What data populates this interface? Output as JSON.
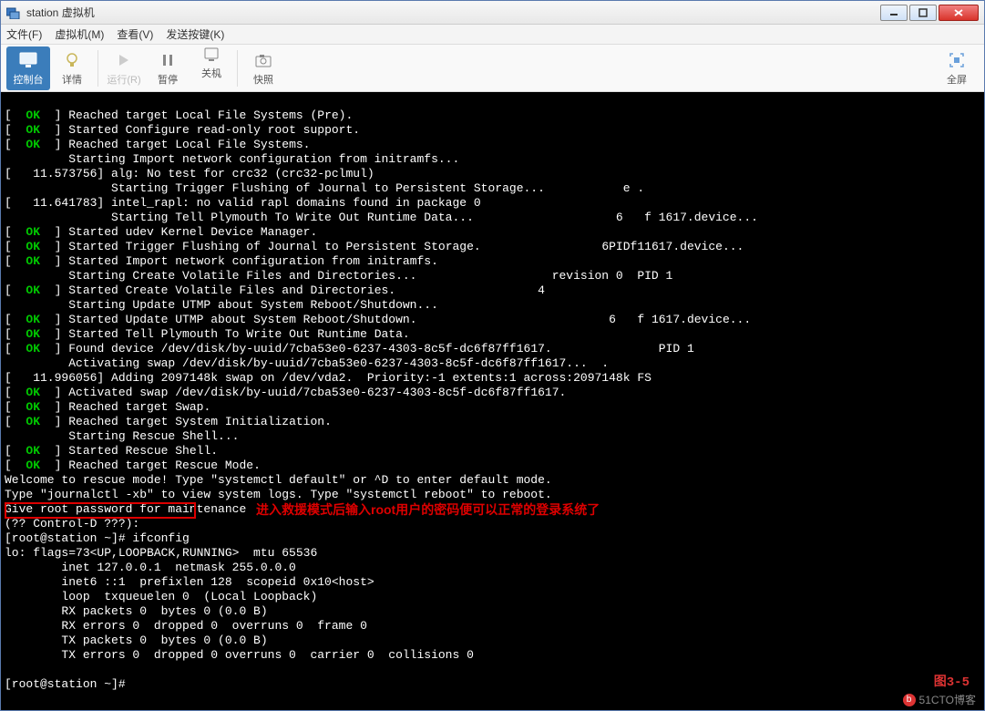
{
  "window": {
    "title": "station 虚拟机"
  },
  "menu": {
    "file": "文件(F)",
    "vm": "虚拟机(M)",
    "view": "查看(V)",
    "send": "发送按键(K)"
  },
  "toolbar": {
    "console": "控制台",
    "details": "详情",
    "run": "运行(R)",
    "pause": "暂停",
    "shutdown": "关机",
    "snapshot": "快照",
    "fullscreen": "全屏"
  },
  "term": {
    "l1": "[   11.573756] alg: No test for crc32 (crc32-pclmul)",
    "l2": "               Starting Trigger Flushing of Journal to Persistent Storage...           e .",
    "l3": "[   11.641783] intel_rapl: no valid rapl domains found in package 0",
    "l4": "               Starting Tell Plymouth To Write Out Runtime Data...                    6   f 1617.device...",
    "ok1": "Reached target Local File Systems (Pre).",
    "ok2": "Started Configure read-only root support.",
    "ok3": "Reached target Local File Systems.",
    "starting_import": "         Starting Import network configuration from initramfs...",
    "ok4": "Started udev Kernel Device Manager.",
    "ok5": "Started Trigger Flushing of Journal to Persistent Storage.                 6PIDf11617.device...",
    "ok6": "Started Import network configuration from initramfs.",
    "starting_volatile": "         Starting Create Volatile Files and Directories...                   revision 0  PID 1",
    "ok7": "Started Create Volatile Files and Directories.                    4",
    "starting_utmp": "         Starting Update UTMP about System Reboot/Shutdown...",
    "ok8": "Started Update UTMP about System Reboot/Shutdown.                           6   f 1617.device...",
    "ok9": "Started Tell Plymouth To Write Out Runtime Data.",
    "ok10": "Found device /dev/disk/by-uuid/7cba53e0-6237-4303-8c5f-dc6f87ff1617.               PID 1",
    "activating": "         Activating swap /dev/disk/by-uuid/7cba53e0-6237-4303-8c5f-dc6f87ff1617...  .",
    "l5": "[   11.996056] Adding 2097148k swap on /dev/vda2.  Priority:-1 extents:1 across:2097148k FS",
    "ok11": "Activated swap /dev/disk/by-uuid/7cba53e0-6237-4303-8c5f-dc6f87ff1617.",
    "ok12": "Reached target Swap.",
    "ok13": "Reached target System Initialization.",
    "starting_rescue": "         Starting Rescue Shell...",
    "ok14": "Started Rescue Shell.",
    "ok15": "Reached target Rescue Mode.",
    "welcome": "Welcome to rescue mode! Type \"systemctl default\" or ^D to enter default mode.",
    "journal": "Type \"journalctl -xb\" to view system logs. Type \"systemctl reboot\" to reboot.",
    "giveroot": "Give root password for maintenance",
    "ctrl_d": "(?? Control-D ???):",
    "prompt1": "[root@station ~]# ifconfig",
    "lo": "lo: flags=73<UP,LOOPBACK,RUNNING>  mtu 65536",
    "inet": "        inet 127.0.0.1  netmask 255.0.0.0",
    "inet6": "        inet6 ::1  prefixlen 128  scopeid 0x10<host>",
    "loop": "        loop  txqueuelen 0  (Local Loopback)",
    "rxp": "        RX packets 0  bytes 0 (0.0 B)",
    "rxe": "        RX errors 0  dropped 0  overruns 0  frame 0",
    "txp": "        TX packets 0  bytes 0 (0.0 B)",
    "txe": "        TX errors 0  dropped 0 overruns 0  carrier 0  collisions 0",
    "prompt2": "[root@station ~]#"
  },
  "annotation": {
    "note": "进入救援模式后输入root用户的密码便可以正常的登录系统了",
    "fig": "图3-5"
  },
  "watermark": {
    "text": "51CTO博客"
  }
}
